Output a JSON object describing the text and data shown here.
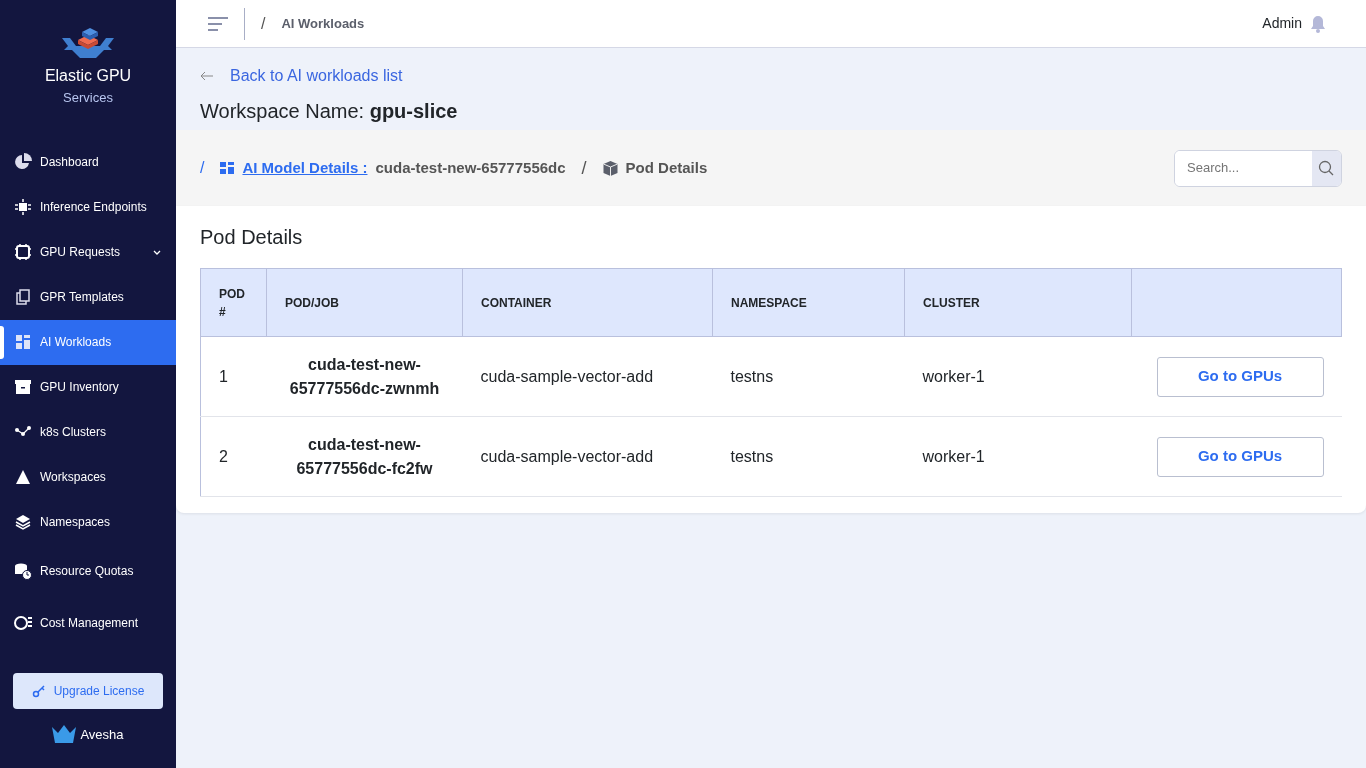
{
  "brand": {
    "title": "Elastic GPU",
    "subtitle": "Services"
  },
  "sidebar": {
    "items": [
      {
        "label": "Dashboard",
        "selected": false
      },
      {
        "label": "Inference Endpoints",
        "selected": false
      },
      {
        "label": "GPU Requests",
        "selected": false,
        "expandable": true
      },
      {
        "label": "GPR Templates",
        "selected": false
      },
      {
        "label": "AI Workloads",
        "selected": true
      },
      {
        "label": "GPU Inventory",
        "selected": false
      },
      {
        "label": "k8s Clusters",
        "selected": false
      },
      {
        "label": "Workspaces",
        "selected": false
      },
      {
        "label": "Namespaces",
        "selected": false
      },
      {
        "label": "Resource Quotas",
        "selected": false
      },
      {
        "label": "Cost Management",
        "selected": false
      }
    ],
    "upgrade_button": "Upgrade License",
    "footer_logo": "Avesha"
  },
  "topbar": {
    "separator": "/",
    "page": "AI Workloads",
    "user": "Admin"
  },
  "back_link": "Back to AI workloads list",
  "workspace_heading": "Workspace Name: **gpu-slice**",
  "breadcrumb": {
    "lead_separator": "/",
    "link": "AI Model Details :",
    "model": "cuda-test-new-65777556dc",
    "separator": "/",
    "current": "Pod Details"
  },
  "search": {
    "placeholder": "Search..."
  },
  "card_title": "Pod Details",
  "table": {
    "columns": [
      "POD #",
      "POD/JOB",
      "CONTAINER",
      "NAMESPACE",
      "CLUSTER"
    ],
    "rows": [
      {
        "pod": "1",
        "job": "cuda-test-new-65777556dc-zwnmh",
        "container": "cuda-sample-vector-add",
        "namespace": "testns",
        "cluster": "worker-1",
        "action": "Go to GPUs"
      },
      {
        "pod": "2",
        "job": "cuda-test-new-65777556dc-fc2fw",
        "container": "cuda-sample-vector-add",
        "namespace": "testns",
        "cluster": "worker-1",
        "action": "Go to GPUs"
      }
    ]
  }
}
